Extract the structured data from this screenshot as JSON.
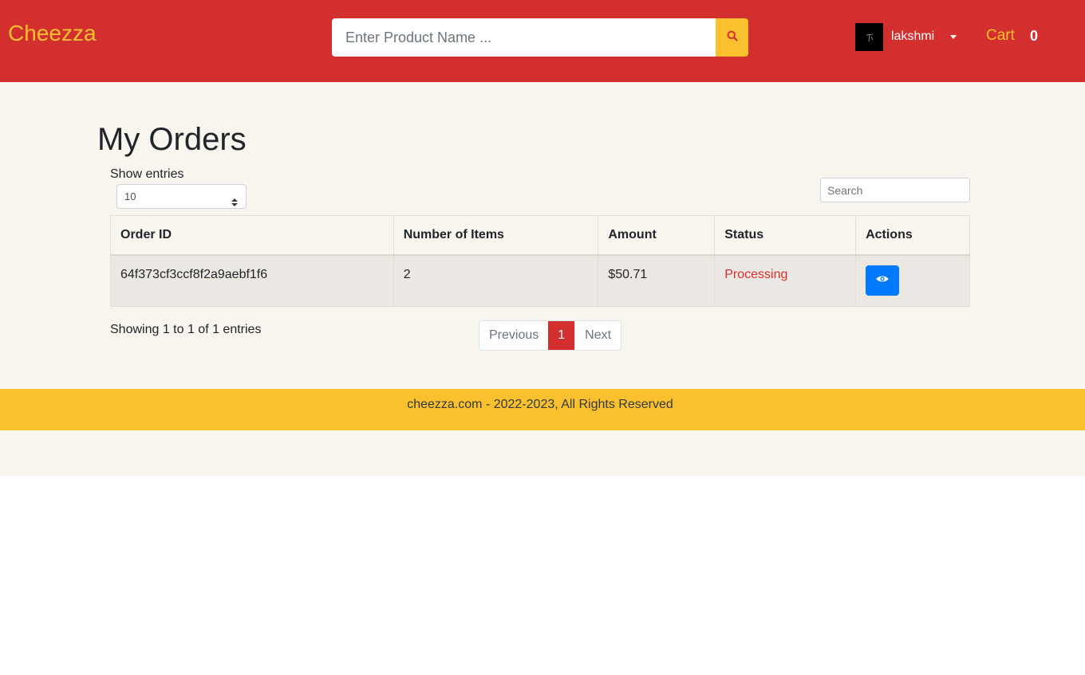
{
  "navbar": {
    "brand": "Cheezza",
    "search_placeholder": "Enter Product Name ...",
    "search_icon": "search-icon",
    "user": {
      "name": "lakshmi",
      "avatar_icon": "avatar-image",
      "dropdown_icon": "caret-down-icon"
    },
    "cart": {
      "label": "Cart",
      "count": "0"
    }
  },
  "main": {
    "title": "My Orders",
    "show_entries_label": "Show entries",
    "entries_value": "10",
    "search_placeholder": "Search",
    "table": {
      "headers": [
        "Order ID",
        "Number of Items",
        "Amount",
        "Status",
        "Actions"
      ],
      "rows": [
        {
          "order_id": "64f373cf3ccf8f2a9aebf1f6",
          "items": "2",
          "amount": "$50.71",
          "status": "Processing",
          "action_icon": "eye-icon"
        }
      ]
    },
    "info": "Showing 1 to 1 of 1 entries",
    "pagination": {
      "previous": "Previous",
      "current": "1",
      "next": "Next"
    }
  },
  "footer": {
    "text": "cheezza.com - 2022-2023, All Rights Reserved"
  },
  "colors": {
    "navbar": "#d32f2f",
    "accent": "#fbc02d",
    "page_bg": "#f8f5ef",
    "primary_button": "#007bff",
    "status_processing": "#dd2c2c"
  }
}
